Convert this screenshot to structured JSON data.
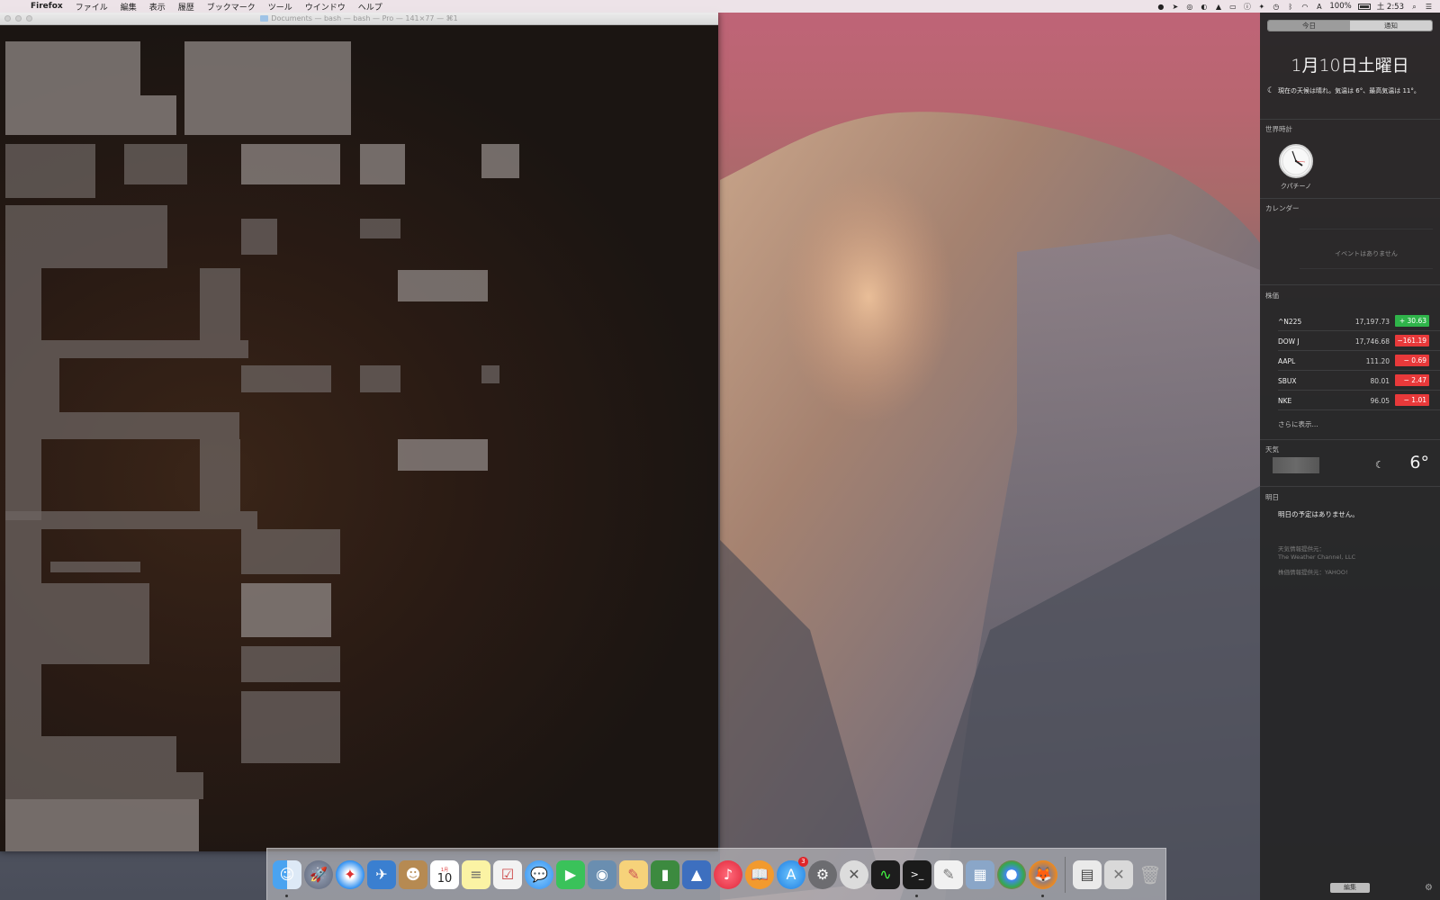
{
  "menubar": {
    "app_name": "Firefox",
    "items": [
      "ファイル",
      "編集",
      "表示",
      "履歴",
      "ブックマーク",
      "ツール",
      "ウインドウ",
      "ヘルプ"
    ],
    "battery": "100%",
    "clock": "土 2:53"
  },
  "terminal": {
    "title": "Documents — bash — bash — Pro — 141×77 — ⌘1"
  },
  "notification_center": {
    "tabs": [
      "今日",
      "通知"
    ],
    "date": "1月10日土曜日",
    "forecast": "現在の天候は晴れ。気温は 6°、最高気温は 11°。",
    "world_clock": {
      "title": "世界時計",
      "city": "クパチーノ"
    },
    "calendar": {
      "title": "カレンダー",
      "empty": "イベントはありません"
    },
    "stocks": {
      "title": "株価",
      "rows": [
        {
          "symbol": "^N225",
          "price": "17,197.73",
          "change": "+ 30.63",
          "direction": "up"
        },
        {
          "symbol": "DOW J",
          "price": "17,746.68",
          "change": "−161.19",
          "direction": "down"
        },
        {
          "symbol": "AAPL",
          "price": "111.20",
          "change": "−  0.69",
          "direction": "down"
        },
        {
          "symbol": "SBUX",
          "price": "80.01",
          "change": "−  2.47",
          "direction": "down"
        },
        {
          "symbol": "NKE",
          "price": "96.05",
          "change": "−  1.01",
          "direction": "down"
        }
      ],
      "more": "さらに表示..."
    },
    "weather": {
      "title": "天気",
      "temp": "6°"
    },
    "tomorrow": {
      "title": "明日",
      "text": "明日の予定はありません。"
    },
    "credits": [
      "天気情報提供元：",
      "The Weather Channel, LLC",
      "株価情報提供元：YAHOO!"
    ],
    "edit_label": "編集"
  },
  "dock": {
    "calendar_day": "10",
    "calendar_month": "1月",
    "appstore_badge": "3"
  },
  "colors": {
    "stock_up": "#2fb44a",
    "stock_down": "#e8393a"
  }
}
